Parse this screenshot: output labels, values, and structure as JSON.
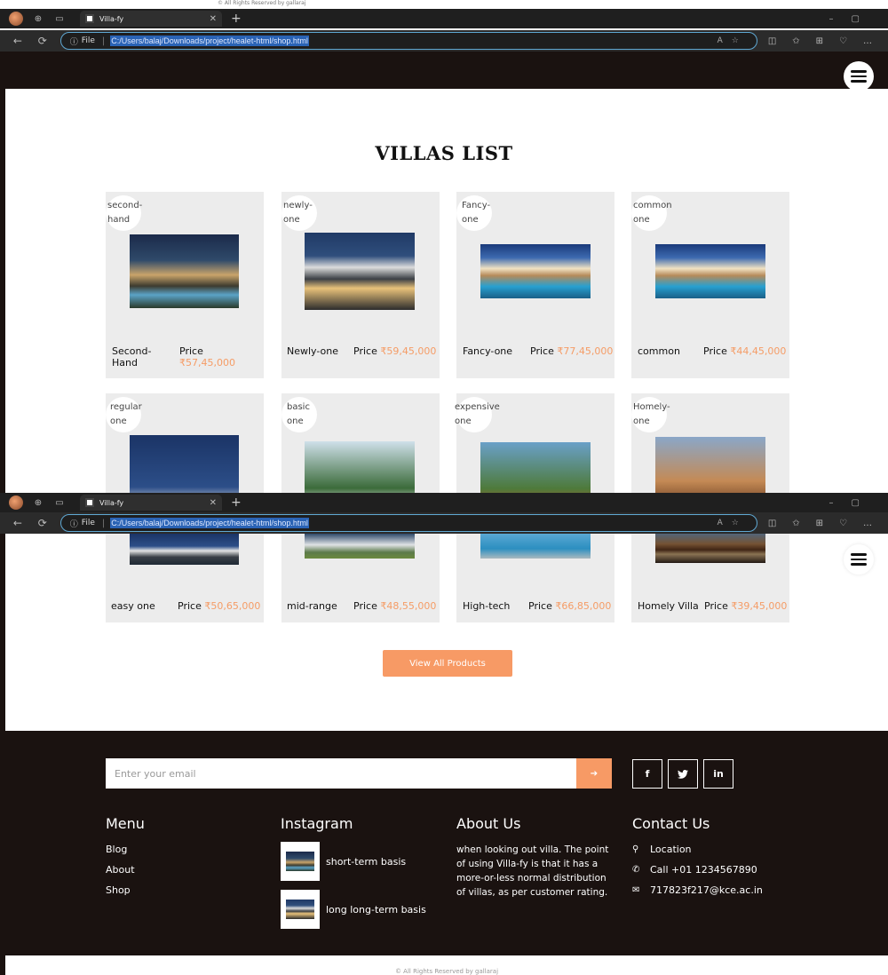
{
  "browser": {
    "tab_title": "Villa-fy",
    "address_file_label": "File",
    "url": "C:/Users/balaj/Downloads/project/healet-html/shop.html",
    "top_text": "© All Rights Reserved by gallaraj"
  },
  "page": {
    "title": "VILLAS LIST",
    "view_all_label": "View All Products",
    "price_label": "Price"
  },
  "products_row1": [
    {
      "tag": "second-hand",
      "name": "Second-Hand",
      "price": "₹57,45,000"
    },
    {
      "tag": "newly-one",
      "name": "Newly-one",
      "price": "₹59,45,000"
    },
    {
      "tag": "Fancy-one",
      "name": "Fancy-one",
      "price": "₹77,45,000"
    },
    {
      "tag": "common one",
      "name": "common",
      "price": "₹44,45,000"
    }
  ],
  "products_row2": [
    {
      "tag": "regular one",
      "name": "easy one",
      "price": "₹50,65,000"
    },
    {
      "tag": "basic one",
      "name": "mid-range",
      "price": "₹48,55,000"
    },
    {
      "tag": "expensive one",
      "name": "High-tech",
      "price": "₹66,85,000"
    },
    {
      "tag": "Homely-one",
      "name": "Homely Villa",
      "price": "₹39,45,000"
    }
  ],
  "footer": {
    "email_placeholder": "Enter your email",
    "email_go": "➔",
    "social": [
      "f",
      "•",
      "in"
    ],
    "menu": {
      "heading": "Menu",
      "items": [
        "Blog",
        "About",
        "Shop"
      ]
    },
    "instagram": {
      "heading": "Instagram",
      "items": [
        "short-term basis",
        "long long-term basis"
      ]
    },
    "about": {
      "heading": "About Us",
      "text": "when looking out villa. The point of using Villa-fy is that it has a more-or-less normal distribution of villas, as per customer rating."
    },
    "contact": {
      "heading": "Contact Us",
      "location": "Location",
      "phone": "Call +01 1234567890",
      "email": "717823f217@kce.ac.in"
    },
    "bottom_text": "© All Rights Reserved by gallaraj"
  }
}
